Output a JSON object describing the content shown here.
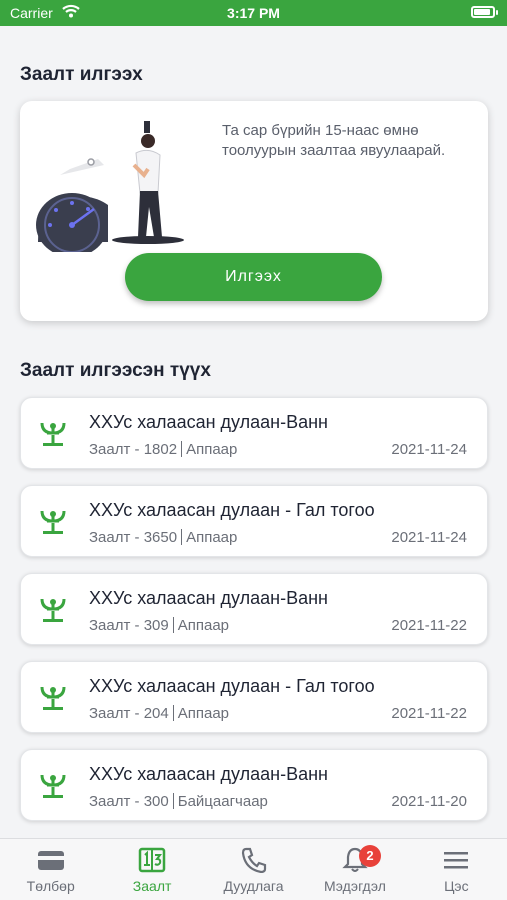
{
  "status_bar": {
    "carrier": "Carrier",
    "time": "3:17 PM"
  },
  "send_section": {
    "title": "Заалт илгээх",
    "info_text": "Та сар бүрийн 15-наас өмнө тоолуурын заалтаа явуулаарай.",
    "button_label": "Илгээх"
  },
  "history_section": {
    "title": "Заалт илгээсэн түүх",
    "items": [
      {
        "title": "ХХУс халаасан дулаан-Ванн",
        "reading": "Заалт - 1802",
        "source": "Аппаар",
        "date": "2021-11-24"
      },
      {
        "title": "ХХУс халаасан дулаан - Гал тогоо",
        "reading": "Заалт - 3650",
        "source": "Аппаар",
        "date": "2021-11-24"
      },
      {
        "title": "ХХУс халаасан дулаан-Ванн",
        "reading": "Заалт - 309",
        "source": "Аппаар",
        "date": "2021-11-22"
      },
      {
        "title": "ХХУс халаасан дулаан - Гал тогоо",
        "reading": "Заалт - 204",
        "source": "Аппаар",
        "date": "2021-11-22"
      },
      {
        "title": "ХХУс халаасан дулаан-Ванн",
        "reading": "Заалт - 300",
        "source": "Байцаагчаар",
        "date": "2021-11-20"
      }
    ]
  },
  "tab_bar": {
    "tabs": [
      {
        "label": "Төлбөр",
        "icon": "wallet-icon",
        "active": false
      },
      {
        "label": "Заалт",
        "icon": "meter-icon",
        "active": true
      },
      {
        "label": "Дуудлага",
        "icon": "phone-icon",
        "active": false
      },
      {
        "label": "Мэдэгдэл",
        "icon": "bell-icon",
        "active": false,
        "badge": "2"
      },
      {
        "label": "Цэс",
        "icon": "menu-icon",
        "active": false
      }
    ]
  },
  "colors": {
    "primary": "#3aa53f",
    "badge": "#e8413a",
    "text_dark": "#1f2433",
    "text_muted": "#6b6f78"
  }
}
